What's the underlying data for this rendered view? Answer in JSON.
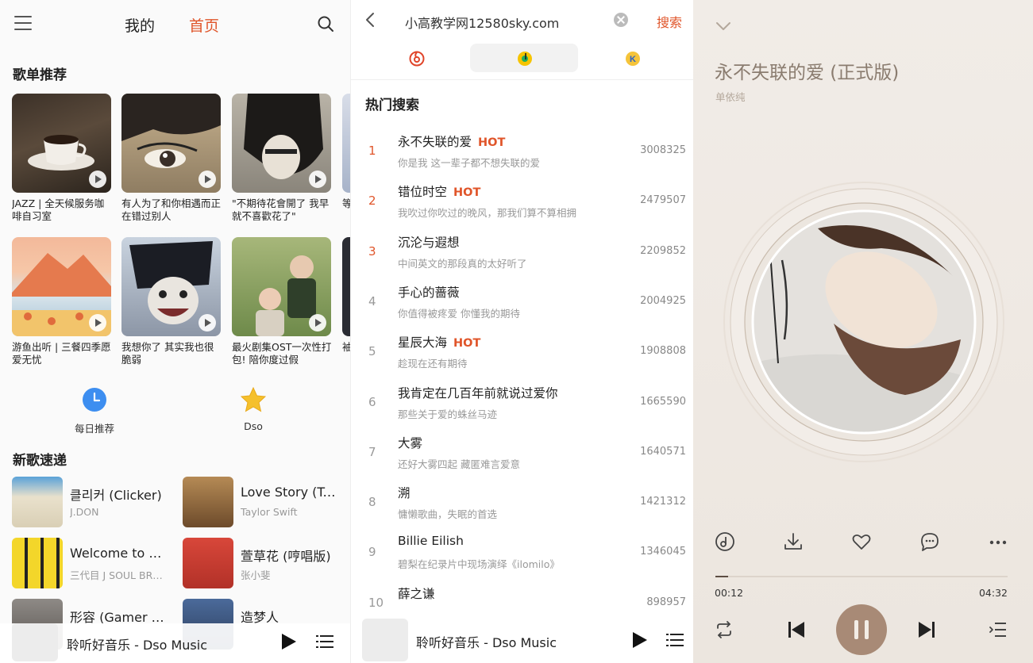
{
  "home": {
    "tabs": {
      "mine": "我的",
      "home": "首页"
    },
    "playlist_section": "歌单推荐",
    "playlists": [
      {
        "caption": "JAZZ | 全天候服务咖啡自习室"
      },
      {
        "caption": "有人为了和你相遇而正在错过别人"
      },
      {
        "caption": "\"不期待花會開了 我早就不喜歡花了\""
      },
      {
        "caption": "等"
      },
      {
        "caption": "游鱼出听 | 三餐四季愿爱无忧"
      },
      {
        "caption": "我想你了 其实我也很脆弱"
      },
      {
        "caption": "最火剧集OST一次性打包! 陪你度过假"
      },
      {
        "caption": "袖"
      }
    ],
    "quick": [
      {
        "label": "每日推荐"
      },
      {
        "label": "Dso"
      }
    ],
    "new_section": "新歌速递",
    "new_songs": [
      {
        "title": "클리커 (Clicker)",
        "artist": "J.DON"
      },
      {
        "title": "Love Story (Taylor's Version)",
        "artist": "Taylor Swift"
      },
      {
        "title": "Welcome to TOKYO",
        "artist": "三代目 J SOUL BROTHERS"
      },
      {
        "title": "萱草花 (哼唱版)",
        "artist": "张小斐"
      },
      {
        "title": "形容 (Gamer Version)",
        "artist": ""
      },
      {
        "title": "造梦人",
        "artist": ""
      }
    ],
    "mini_player": {
      "title": "聆听好音乐 - Dso Music"
    }
  },
  "search": {
    "query": "小高教学网12580sky.com",
    "search_label": "搜索",
    "hot_title": "热门搜索",
    "hot_badge": "HOT",
    "items": [
      {
        "rank": "1",
        "name": "永不失联的爱",
        "hot": true,
        "desc": "你是我 这一辈子都不想失联的爱",
        "count": "3008325"
      },
      {
        "rank": "2",
        "name": "错位时空",
        "hot": true,
        "desc": "我吹过你吹过的晚风，那我们算不算相拥",
        "count": "2479507"
      },
      {
        "rank": "3",
        "name": "沉沦与遐想",
        "hot": false,
        "desc": "中间英文的那段真的太好听了",
        "count": "2209852"
      },
      {
        "rank": "4",
        "name": "手心的蔷薇",
        "hot": false,
        "desc": "你值得被疼爱 你懂我的期待",
        "count": "2004925"
      },
      {
        "rank": "5",
        "name": "星辰大海",
        "hot": true,
        "desc": "趁现在还有期待",
        "count": "1908808"
      },
      {
        "rank": "6",
        "name": "我肯定在几百年前就说过爱你",
        "hot": false,
        "desc": "那些关于爱的蛛丝马迹",
        "count": "1665590"
      },
      {
        "rank": "7",
        "name": "大雾",
        "hot": false,
        "desc": "还好大雾四起 藏匿难言爱意",
        "count": "1640571"
      },
      {
        "rank": "8",
        "name": "溯",
        "hot": false,
        "desc": "慵懒歌曲，失眠的首选",
        "count": "1421312"
      },
      {
        "rank": "9",
        "name": "Billie Eilish",
        "hot": false,
        "desc": "碧梨在纪录片中现场演绎《ilomilo》",
        "count": "1346045"
      },
      {
        "rank": "10",
        "name": "薛之谦",
        "hot": false,
        "desc": "",
        "count": "898957"
      }
    ],
    "mini_player": {
      "title": "聆听好音乐 - Dso Music"
    }
  },
  "player": {
    "title": "永不失联的爱 (正式版)",
    "artist": "单依纯",
    "elapsed": "00:12",
    "duration": "04:32",
    "progress": 0.044
  }
}
